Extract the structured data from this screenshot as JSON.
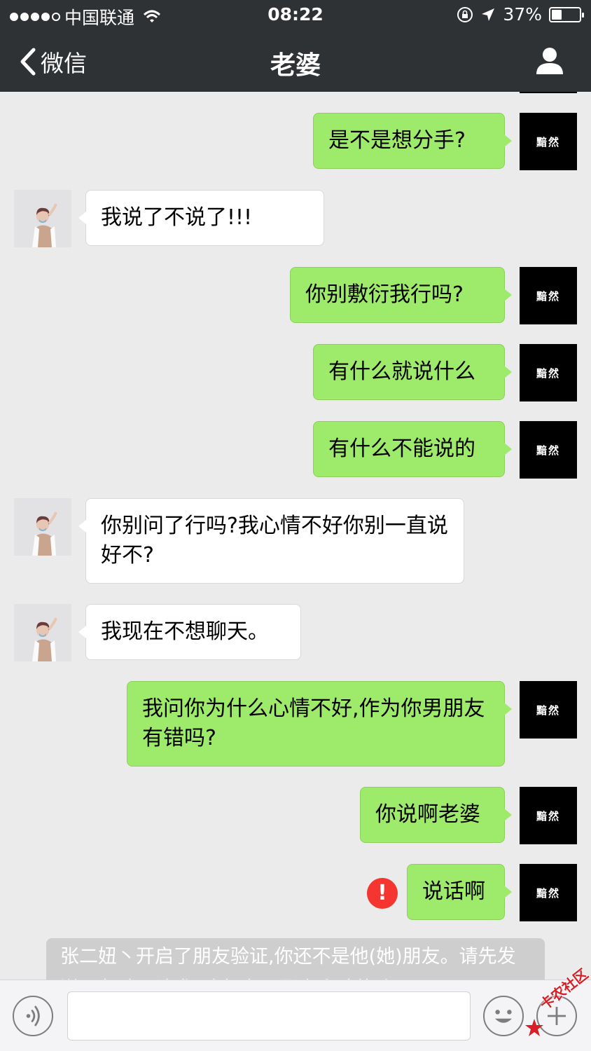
{
  "status_bar": {
    "carrier": "中国联通",
    "time": "08:22",
    "battery": "37%",
    "battery_level": 0.37
  },
  "nav": {
    "back_label": "微信",
    "title": "老婆"
  },
  "avatars": {
    "me_text": "黯然"
  },
  "messages": [
    {
      "from": "me",
      "text": "是不是想分手?"
    },
    {
      "from": "her",
      "text": "我说了不说了!!!"
    },
    {
      "from": "me",
      "text": "你别敷衍我行吗?"
    },
    {
      "from": "me",
      "text": "有什么就说什么"
    },
    {
      "from": "me",
      "text": "有什么不能说的"
    },
    {
      "from": "her",
      "text": "你别问了行吗?我心情不好你别一直说好不?"
    },
    {
      "from": "her",
      "text": "我现在不想聊天。"
    },
    {
      "from": "me",
      "text": "我问你为什么心情不好,作为你男朋友有错吗?"
    },
    {
      "from": "me",
      "text": "你说啊老婆"
    },
    {
      "from": "me",
      "text": "说话啊",
      "failed": true
    }
  ],
  "error_mark": "!",
  "system_notice": "张二妞丶开启了朋友验证,你还不是他(她)朋友。请先发送朋友验证请求,对方验证通过后,才能聊天。",
  "input": {
    "value": "",
    "placeholder": ""
  },
  "watermark": "卡农社区",
  "colors": {
    "nav_bg": "#2f3235",
    "chat_bg": "#ebebeb",
    "my_bubble": "#9eea6a",
    "her_bubble": "#ffffff",
    "error": "#f43530"
  }
}
